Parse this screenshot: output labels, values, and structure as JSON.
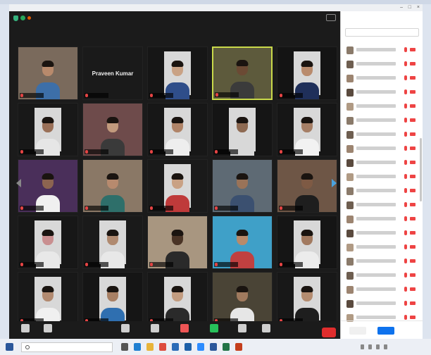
{
  "window": {
    "title": "",
    "recording_label": "",
    "view_label": ""
  },
  "tiles": [
    {
      "name": "",
      "text": ""
    },
    {
      "name": "",
      "text": "Praveen Kumar"
    },
    {
      "name": ""
    },
    {
      "name": ""
    },
    {
      "name": ""
    },
    {
      "name": ""
    },
    {
      "name": ""
    },
    {
      "name": ""
    },
    {
      "name": ""
    },
    {
      "name": ""
    },
    {
      "name": ""
    },
    {
      "name": ""
    },
    {
      "name": ""
    },
    {
      "name": ""
    },
    {
      "name": ""
    },
    {
      "name": ""
    },
    {
      "name": ""
    },
    {
      "name": ""
    },
    {
      "name": ""
    },
    {
      "name": ""
    },
    {
      "name": ""
    },
    {
      "name": ""
    },
    {
      "name": ""
    },
    {
      "name": ""
    },
    {
      "name": ""
    }
  ],
  "toolbar": {
    "buttons": [
      {
        "label": "",
        "icon": "microphone-icon"
      },
      {
        "label": "",
        "icon": "video-camera-icon"
      },
      {
        "label": "",
        "icon": "security-icon"
      },
      {
        "label": "",
        "icon": "participants-icon"
      },
      {
        "label": "",
        "icon": "chat-icon"
      },
      {
        "label": "",
        "icon": "share-screen-icon"
      },
      {
        "label": "",
        "icon": "record-icon"
      },
      {
        "label": "",
        "icon": "reactions-icon"
      }
    ],
    "end_label": ""
  },
  "participants_panel": {
    "title": "",
    "search_placeholder": "",
    "invite_label": "",
    "mute_all_label": "",
    "more_label": "",
    "items": [
      {
        "name": ""
      },
      {
        "name": ""
      },
      {
        "name": ""
      },
      {
        "name": ""
      },
      {
        "name": ""
      },
      {
        "name": ""
      },
      {
        "name": ""
      },
      {
        "name": ""
      },
      {
        "name": ""
      },
      {
        "name": ""
      },
      {
        "name": ""
      },
      {
        "name": ""
      },
      {
        "name": ""
      },
      {
        "name": ""
      },
      {
        "name": ""
      },
      {
        "name": ""
      },
      {
        "name": ""
      },
      {
        "name": ""
      },
      {
        "name": ""
      },
      {
        "name": ""
      }
    ]
  },
  "taskbar": {
    "search_text": "",
    "time": "",
    "date": ""
  },
  "colors": {
    "end_button": "#e02d2d",
    "active_speaker_border": "#c9d94a",
    "mute_all_button": "#0e72ed",
    "muted_indicator": "#e44444"
  }
}
